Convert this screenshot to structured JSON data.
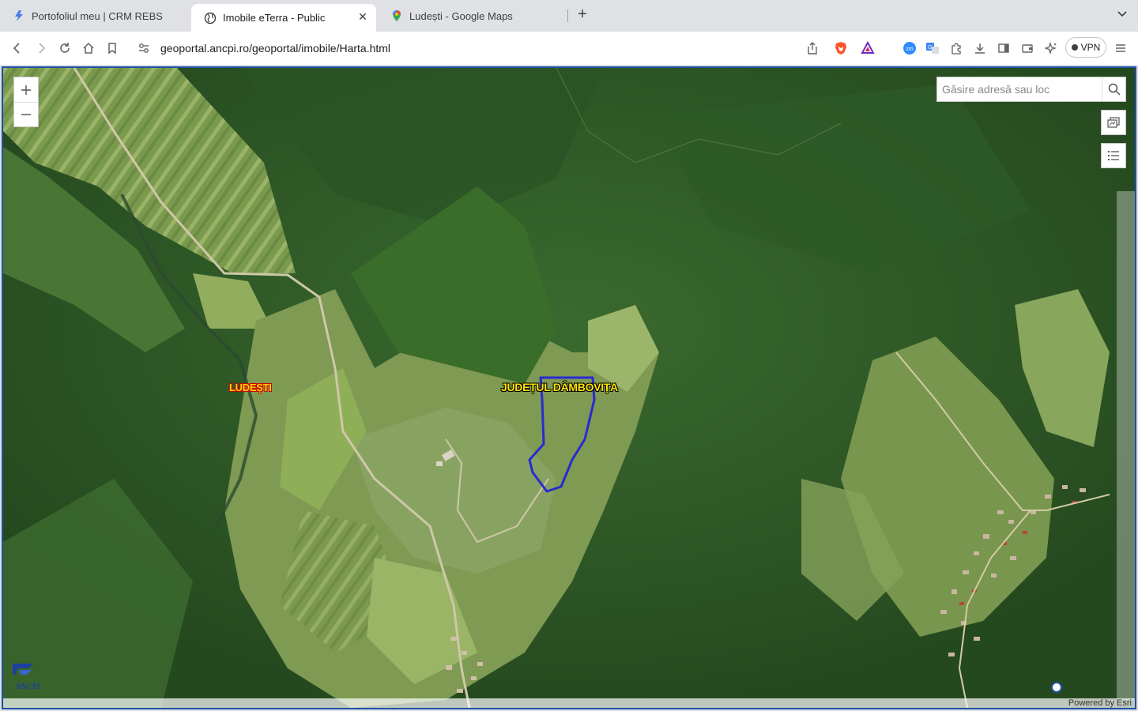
{
  "browser": {
    "tabs": [
      {
        "title": "Portofoliul meu | CRM REBS",
        "active": false
      },
      {
        "title": "Imobile eTerra - Public",
        "active": true
      },
      {
        "title": "Ludești - Google Maps",
        "active": false
      }
    ],
    "url": "geoportal.ancpi.ro/geoportal/imobile/Harta.html",
    "vpn_label": "VPN",
    "colors": {
      "tabstrip": "#dfe1e5",
      "toolbar": "#ffffff",
      "brave": "#fb542b"
    }
  },
  "map": {
    "search_placeholder": "Găsire adresă sau loc",
    "labels": {
      "county": "JUDEȚUL DÂMBOVIȚA",
      "locality": "LUDEȘTI"
    },
    "attribution": "Powered by Esri",
    "logo_text": "ANCPI",
    "colors": {
      "parcel_outline": "#2a2ad0",
      "frame": "#1e4fa8",
      "label_fill": "#ffe400"
    },
    "icons": {
      "zoom_in": "plus-icon",
      "zoom_out": "minus-icon",
      "search": "search-icon",
      "basemap": "basemap-gallery-icon",
      "layers": "layer-list-icon"
    }
  }
}
